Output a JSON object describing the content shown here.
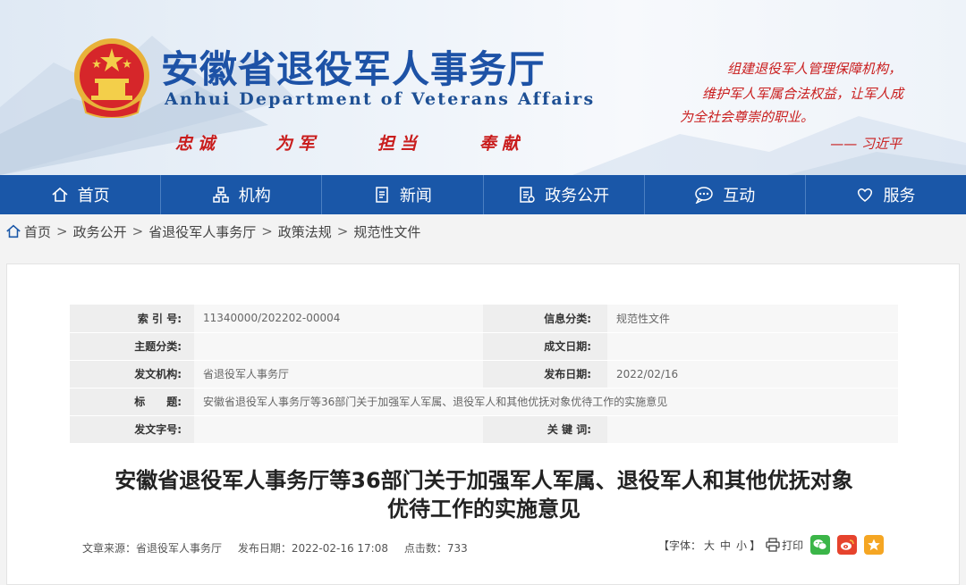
{
  "header": {
    "title_cn": "安徽省退役军人事务厅",
    "title_en": "Anhui Department of Veterans Affairs",
    "motto": [
      "忠诚",
      "为军",
      "担当",
      "奉献"
    ],
    "quote_lines": [
      "组建退役军人管理保障机构，",
      "维护军人军属合法权益，让军人成",
      "为全社会尊崇的职业。"
    ],
    "quote_author": "—— 习近平"
  },
  "nav": [
    {
      "label": "首页",
      "icon": "home-icon"
    },
    {
      "label": "机构",
      "icon": "org-chart-icon"
    },
    {
      "label": "新闻",
      "icon": "document-icon"
    },
    {
      "label": "政务公开",
      "icon": "list-document-icon"
    },
    {
      "label": "互动",
      "icon": "chat-icon"
    },
    {
      "label": "服务",
      "icon": "heart-icon"
    }
  ],
  "breadcrumb": [
    "首页",
    "政务公开",
    "省退役军人事务厅",
    "政策法规",
    "规范性文件"
  ],
  "meta": {
    "index_label": "索 引 号:",
    "index_value": "11340000/202202-00004",
    "info_class_label": "信息分类:",
    "info_class_value": "规范性文件",
    "topic_label": "主题分类:",
    "topic_value": "",
    "created_label": "成文日期:",
    "created_value": "",
    "issuer_label": "发文机构:",
    "issuer_value": "省退役军人事务厅",
    "publish_label": "发布日期:",
    "publish_value": "2022/02/16",
    "title_label": "标　　题:",
    "title_value": "安徽省退役军人事务厅等36部门关于加强军人军属、退役军人和其他优抚对象优待工作的实施意见",
    "docno_label": "发文字号:",
    "docno_value": "",
    "keywords_label": "关 键 词:",
    "keywords_value": ""
  },
  "article": {
    "title_line1": "安徽省退役军人事务厅等36部门关于加强军人军属、退役军人和其他优抚对象",
    "title_line2": "优待工作的实施意见",
    "source": "文章来源：省退役军人事务厅",
    "date": "发布日期：2022-02-16 17:08",
    "clicks": "点击数：733"
  },
  "tools": {
    "font_prefix": "【字体：",
    "font_large": "大",
    "font_medium": "中",
    "font_small": "小",
    "font_suffix": "】",
    "print_label": "打印"
  },
  "colors": {
    "nav_bg": "#1a57a8",
    "title_blue": "#1d52a6",
    "motto_red": "#c91d1d",
    "wechat": "#3bb548",
    "weibo": "#e6432d",
    "favorite": "#f5a623"
  }
}
